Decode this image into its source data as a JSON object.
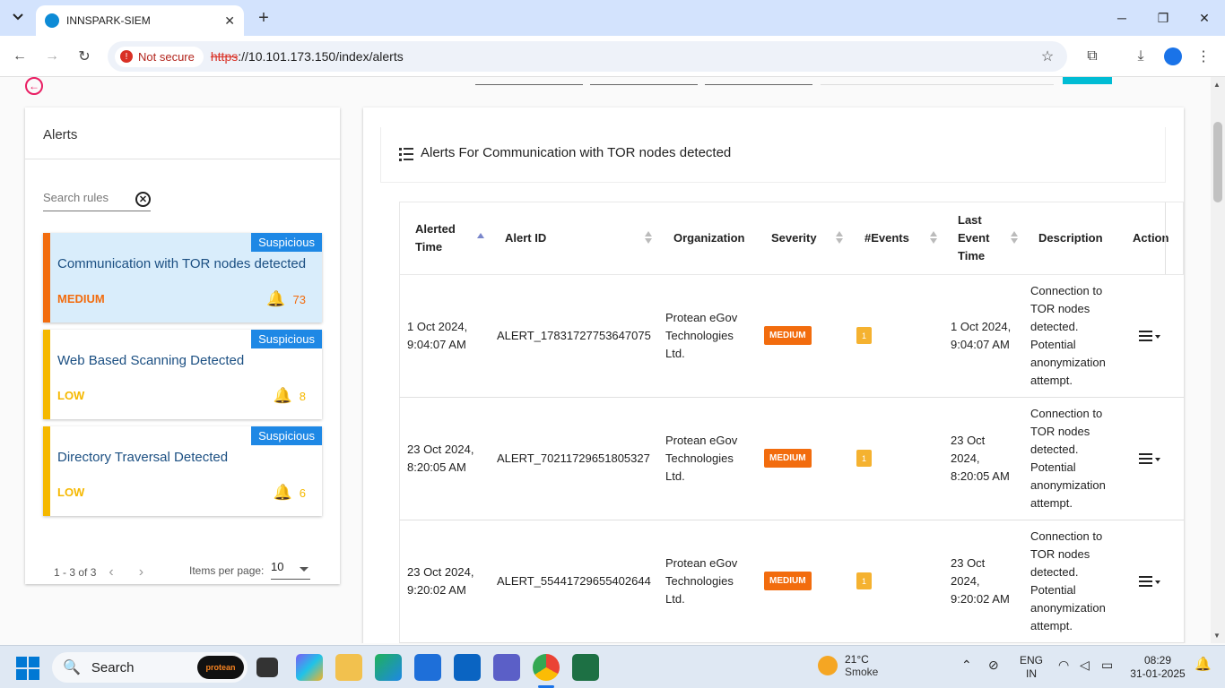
{
  "browser": {
    "tab_title": "INNSPARK-SIEM",
    "not_secure_label": "Not secure",
    "url_scheme": "https",
    "url_rest": "://10.101.173.150/index/alerts"
  },
  "sidebar": {
    "title": "Alerts",
    "search_placeholder": "Search rules",
    "rules": [
      {
        "tag": "Suspicious",
        "name": "Communication with TOR nodes detected",
        "severity": "MEDIUM",
        "count": "73",
        "color": "#f26c0e"
      },
      {
        "tag": "Suspicious",
        "name": "Web Based Scanning Detected",
        "severity": "LOW",
        "count": "8",
        "color": "#f5b800"
      },
      {
        "tag": "Suspicious",
        "name": "Directory Traversal Detected",
        "severity": "LOW",
        "count": "6",
        "color": "#f5b800"
      }
    ],
    "pager_range": "1 - 3 of 3",
    "items_per_page_label": "Items per page:",
    "items_per_page_value": "10"
  },
  "main": {
    "title": "Alerts For Communication with TOR nodes detected",
    "columns": {
      "alerted_time": "Alerted Time",
      "alert_id": "Alert ID",
      "organization": "Organization",
      "severity": "Severity",
      "events": "#Events",
      "last_event_time": "Last Event Time",
      "description": "Description",
      "action": "Action"
    },
    "rows": [
      {
        "alerted_time": "1 Oct 2024, 9:04:07 AM",
        "alert_id": "ALERT_17831727753647075",
        "organization": "Protean eGov Technologies Ltd.",
        "severity": "MEDIUM",
        "events": "1",
        "last_event_time": "1 Oct 2024, 9:04:07 AM",
        "description": "Connection to TOR nodes detected. Potential anonymization attempt."
      },
      {
        "alerted_time": "23 Oct 2024, 8:20:05 AM",
        "alert_id": "ALERT_70211729651805327",
        "organization": "Protean eGov Technologies Ltd.",
        "severity": "MEDIUM",
        "events": "1",
        "last_event_time": "23 Oct 2024, 8:20:05 AM",
        "description": "Connection to TOR nodes detected. Potential anonymization attempt."
      },
      {
        "alerted_time": "23 Oct 2024, 9:20:02 AM",
        "alert_id": "ALERT_55441729655402644",
        "organization": "Protean eGov Technologies Ltd.",
        "severity": "MEDIUM",
        "events": "1",
        "last_event_time": "23 Oct 2024, 9:20:02 AM",
        "description": "Connection to TOR nodes detected. Potential anonymization attempt."
      }
    ]
  },
  "taskbar": {
    "search_label": "Search",
    "protean_label": "protean",
    "weather_temp": "21°C",
    "weather_desc": "Smoke",
    "lang_line1": "ENG",
    "lang_line2": "IN",
    "time": "08:29",
    "date": "31-01-2025"
  },
  "icons": [
    "tab-list-icon",
    "favicon-icon",
    "close-tab-icon",
    "new-tab-icon",
    "minimize-icon",
    "maximize-icon",
    "close-window-icon",
    "back-icon",
    "forward-icon",
    "reload-icon",
    "bookmark-star-icon",
    "extensions-icon",
    "download-icon",
    "profile-icon",
    "menu-kebab-icon",
    "back-circle-icon",
    "clear-search-icon",
    "bell-icon",
    "list-icon",
    "action-menu-icon",
    "windows-start-icon",
    "search-icon"
  ]
}
